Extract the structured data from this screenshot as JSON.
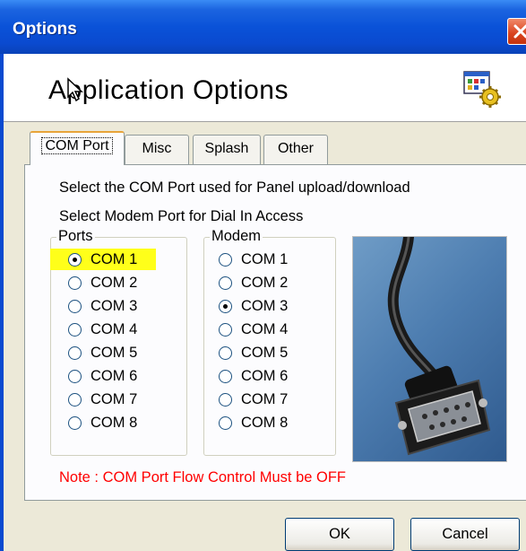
{
  "window": {
    "title": "Options"
  },
  "header": {
    "title": "Application Options"
  },
  "tabs": [
    {
      "label": "COM Port"
    },
    {
      "label": "Misc"
    },
    {
      "label": "Splash"
    },
    {
      "label": "Other"
    }
  ],
  "com_tab": {
    "line1": "Select the COM Port used for Panel upload/download",
    "line2": "Select Modem Port for Dial In Access",
    "ports_group": {
      "label": "Ports",
      "options": [
        "COM 1",
        "COM 2",
        "COM 3",
        "COM 4",
        "COM 5",
        "COM 6",
        "COM 7",
        "COM 8"
      ],
      "selected": "COM 1"
    },
    "modem_group": {
      "label": "Modem",
      "options": [
        "COM 1",
        "COM 2",
        "COM 3",
        "COM 4",
        "COM 5",
        "COM 6",
        "COM 7",
        "COM 8"
      ],
      "selected": "COM 3"
    },
    "note": "Note : COM Port Flow Control Must be OFF"
  },
  "buttons": {
    "ok": "OK",
    "cancel": "Cancel"
  },
  "colors": {
    "note": "#ff0000",
    "highlight": "#ffff1a",
    "titlebar": "#0a52d8"
  }
}
